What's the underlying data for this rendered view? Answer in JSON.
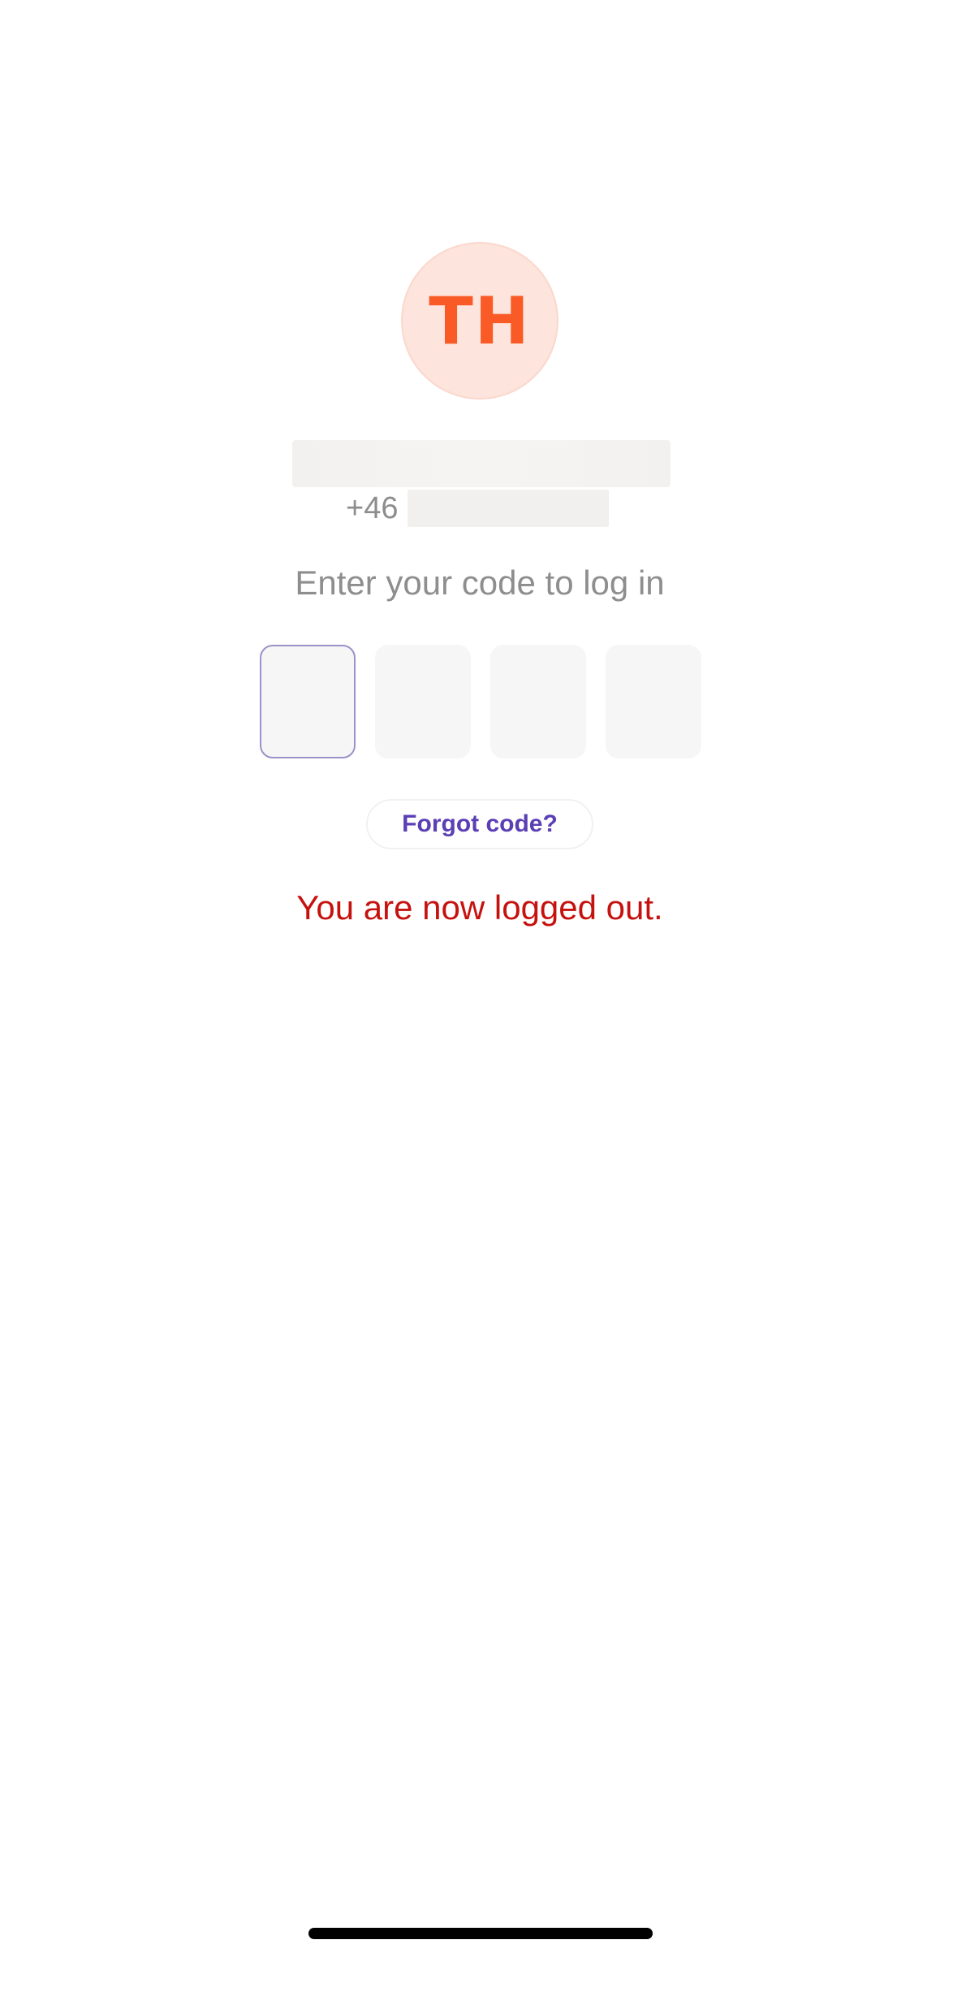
{
  "profile": {
    "initials": "TH",
    "phone_prefix": "+46"
  },
  "login": {
    "instruction": "Enter your code to log in",
    "code_digits": [
      "",
      "",
      "",
      ""
    ],
    "forgot_label": "Forgot code?",
    "status_message": "You are now logged out."
  },
  "colors": {
    "avatar_bg": "#fde4dc",
    "avatar_text": "#f95a26",
    "accent": "#5b3fb4",
    "error": "#c5120f"
  }
}
